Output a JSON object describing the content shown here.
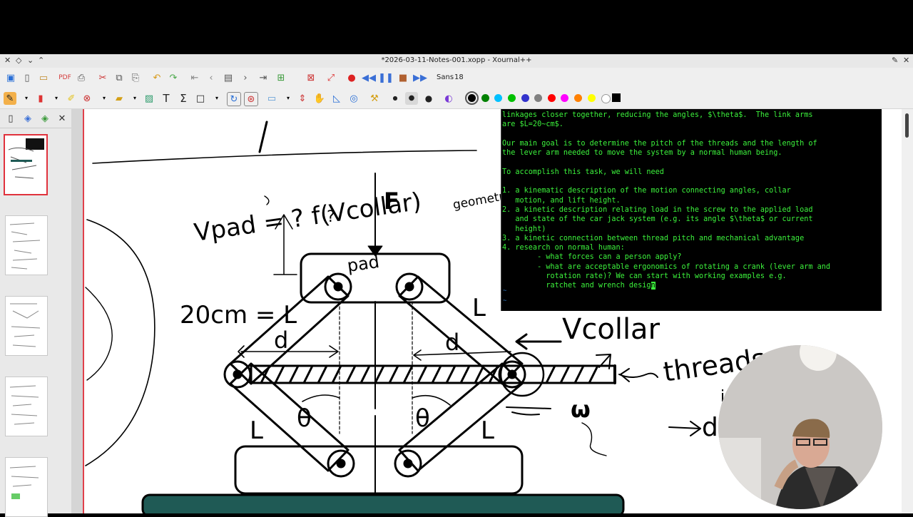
{
  "window": {
    "title": "*2026-03-11-Notes-001.xopp - Xournal++"
  },
  "toolbar": {
    "font_name": "Sans",
    "font_size": "18",
    "icons": [
      "save-icon",
      "new-page-icon",
      "open-icon",
      "export-pdf-icon",
      "print-icon",
      "cut-icon",
      "copy-icon",
      "paste-icon",
      "undo-icon",
      "redo-icon",
      "first-page-icon",
      "previous-page-icon",
      "goto-page-icon",
      "next-page-icon",
      "last-page-icon",
      "add-page-icon",
      "delete-page-icon",
      "fullscreen-icon",
      "record-icon",
      "rewind-icon",
      "pause-icon",
      "stop-icon",
      "fast-forward-icon"
    ],
    "colors": [
      "#000000",
      "#008000",
      "#00c0ff",
      "#00c000",
      "#3333cc",
      "#808080",
      "#ff0000",
      "#ff00ff",
      "#ff8000",
      "#ffff00",
      "#ffffff"
    ]
  },
  "sidebar": {
    "pages": [
      "page-1",
      "page-2",
      "page-3",
      "page-4",
      "page-5"
    ],
    "selected_page": 1
  },
  "drawing": {
    "labels": {
      "v_pad": "Vpad = ? f(Vcollar)",
      "question": "?",
      "force": "F",
      "geometry_of_motion": "geometry of motion",
      "pad": "pad",
      "length_eq": "20cm = L",
      "link_length": "L",
      "distance": "d",
      "v_collar": "Vcollar",
      "threads": "threads",
      "theta": "θ",
      "omega": "ω",
      "arrow_d": "→ d",
      "in": "in"
    }
  },
  "terminal": {
    "lines": [
      "linkages closer together, reducing the angles, $\\theta$.  The link arms",
      "are $L=20~cm$.",
      "",
      "Our main goal is to determine the pitch of the threads and the length of",
      "the lever arm needed to move the system by a normal human being.",
      "",
      "To accomplish this task, we will need",
      "",
      "1. a kinematic description of the motion connecting angles, collar",
      "   motion, and lift height.",
      "2. a kinetic description relating load in the screw to the applied load",
      "   and state of the car jack system (e.g. its angle $\\theta$ or current",
      "   height)",
      "3. a kinetic connection between thread pitch and mechanical advantage",
      "4. research on normal human:",
      "        - what forces can a person apply?",
      "        - what are acceptable ergonomics of rotating a crank (lever arm and",
      "          rotation rate)? We can start with working examples e.g.",
      "          ratchet and wrench desig"
    ],
    "cursor_char": "n",
    "empty_line_marker": "~"
  },
  "colors": {
    "terminal_text": "#3cf23c",
    "ink": "#000000",
    "page_border": "#e0404a",
    "base_plate": "#1f5a55"
  }
}
